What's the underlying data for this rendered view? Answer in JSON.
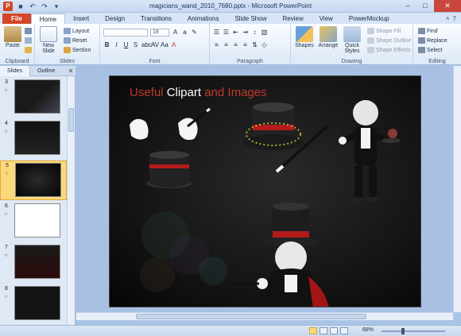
{
  "titlebar": {
    "title": "magicians_wand_2010_7680.pptx - Microsoft PowerPoint",
    "app_letter": "P"
  },
  "tabs": [
    "File",
    "Home",
    "Insert",
    "Design",
    "Transitions",
    "Animations",
    "Slide Show",
    "Review",
    "View",
    "PowerMockup"
  ],
  "ribbon": {
    "clipboard": {
      "paste": "Paste",
      "label": "Clipboard"
    },
    "slides": {
      "new_slide": "New Slide",
      "layout": "Layout",
      "reset": "Reset",
      "section": "Section",
      "label": "Slides"
    },
    "font": {
      "size": "18",
      "label": "Font"
    },
    "paragraph": {
      "label": "Paragraph"
    },
    "drawing": {
      "shapes": "Shapes",
      "arrange": "Arrange",
      "quick_styles": "Quick Styles",
      "shape_fill": "Shape Fill",
      "shape_outline": "Shape Outline",
      "shape_effects": "Shape Effects",
      "label": "Drawing"
    },
    "editing": {
      "find": "Find",
      "replace": "Replace",
      "select": "Select",
      "label": "Editing"
    }
  },
  "leftpane": {
    "tabs": [
      "Slides",
      "Outline"
    ],
    "slides": [
      "3",
      "4",
      "5",
      "6",
      "7",
      "8"
    ],
    "selected": "5"
  },
  "slide": {
    "title_part1": "Useful ",
    "title_part2": "Clipart",
    "title_part3": " and Images"
  },
  "statusbar": {
    "zoom": "68%",
    "zoom_fraction": 0.68
  },
  "colors": {
    "file_tab": "#d24726",
    "title_red": "#c0392b",
    "selected_slide": "#fbd97a"
  }
}
